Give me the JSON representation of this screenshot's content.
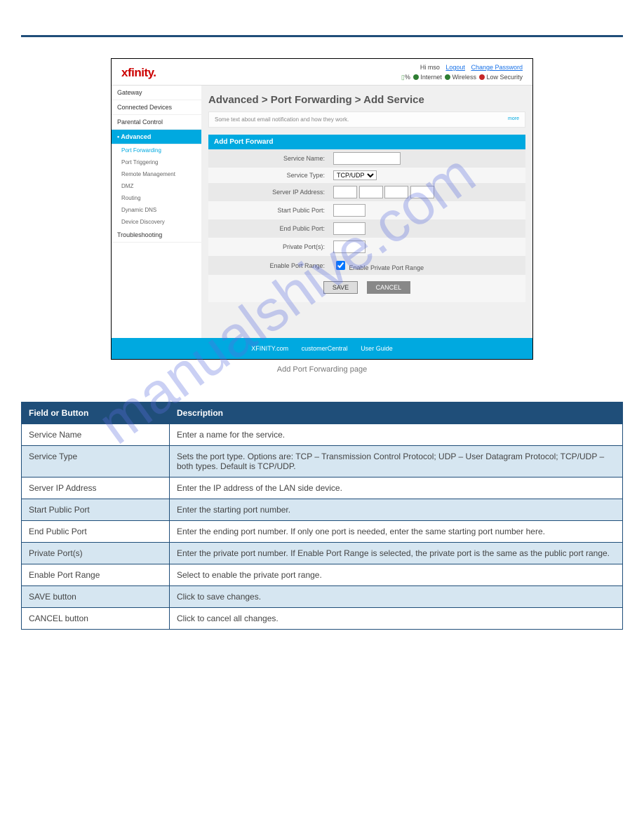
{
  "page": {
    "caption": "Add Port Forwarding page"
  },
  "screenshot": {
    "logo": "xfinity.",
    "greeting": "Hi mso",
    "link_logout": "Logout",
    "link_changepw": "Change Password",
    "status_internet": "Internet",
    "status_wireless": "Wireless",
    "status_security": "Low Security",
    "sidebar": {
      "gateway": "Gateway",
      "connected": "Connected Devices",
      "parental": "Parental Control",
      "advanced": "Advanced",
      "troubleshooting": "Troubleshooting",
      "sub": {
        "pf": "Port Forwarding",
        "pt": "Port Triggering",
        "rm": "Remote Management",
        "dmz": "DMZ",
        "routing": "Routing",
        "ddns": "Dynamic DNS",
        "dd": "Device Discovery"
      }
    },
    "title": "Advanced > Port Forwarding > Add Service",
    "note": "Some text about email notification and how they work.",
    "note_more": "more",
    "panel_header": "Add Port Forward",
    "form": {
      "service_name": "Service Name:",
      "service_type": "Service Type:",
      "service_type_value": "TCP/UDP",
      "server_ip": "Server IP Address:",
      "start_port": "Start Public Port:",
      "end_port": "End Public Port:",
      "private_port": "Private Port(s):",
      "enable_range": "Enable Port Range:",
      "enable_range_cb": "Enable Private Port Range"
    },
    "btn_save": "SAVE",
    "btn_cancel": "CANCEL",
    "footer_a": "XFINITY.com",
    "footer_b": "customerCentral",
    "footer_c": "User Guide"
  },
  "table": {
    "col_field": "Field or Button",
    "col_desc": "Description",
    "rows": [
      {
        "field": "Service Name",
        "desc": "Enter a name for the service."
      },
      {
        "field": "Service Type",
        "desc": "Sets the port type. Options are: TCP – Transmission Control Protocol; UDP – User Datagram Protocol; TCP/UDP – both types. Default is TCP/UDP."
      },
      {
        "field": "Server IP Address",
        "desc": "Enter the IP address of the LAN side device."
      },
      {
        "field": "Start Public Port",
        "desc": "Enter the starting port number."
      },
      {
        "field": "End Public Port",
        "desc": "Enter the ending port number. If only one port is needed, enter the same starting port number here."
      },
      {
        "field": "Private Port(s)",
        "desc": "Enter the private port number. If Enable Port Range is selected, the private port is the same as the public port range."
      },
      {
        "field": "Enable Port Range",
        "desc": "Select to enable the private port range."
      },
      {
        "field": "SAVE button",
        "desc": "Click to save changes."
      },
      {
        "field": "CANCEL button",
        "desc": "Click to cancel all changes."
      }
    ]
  },
  "watermark": "manualshive.com"
}
